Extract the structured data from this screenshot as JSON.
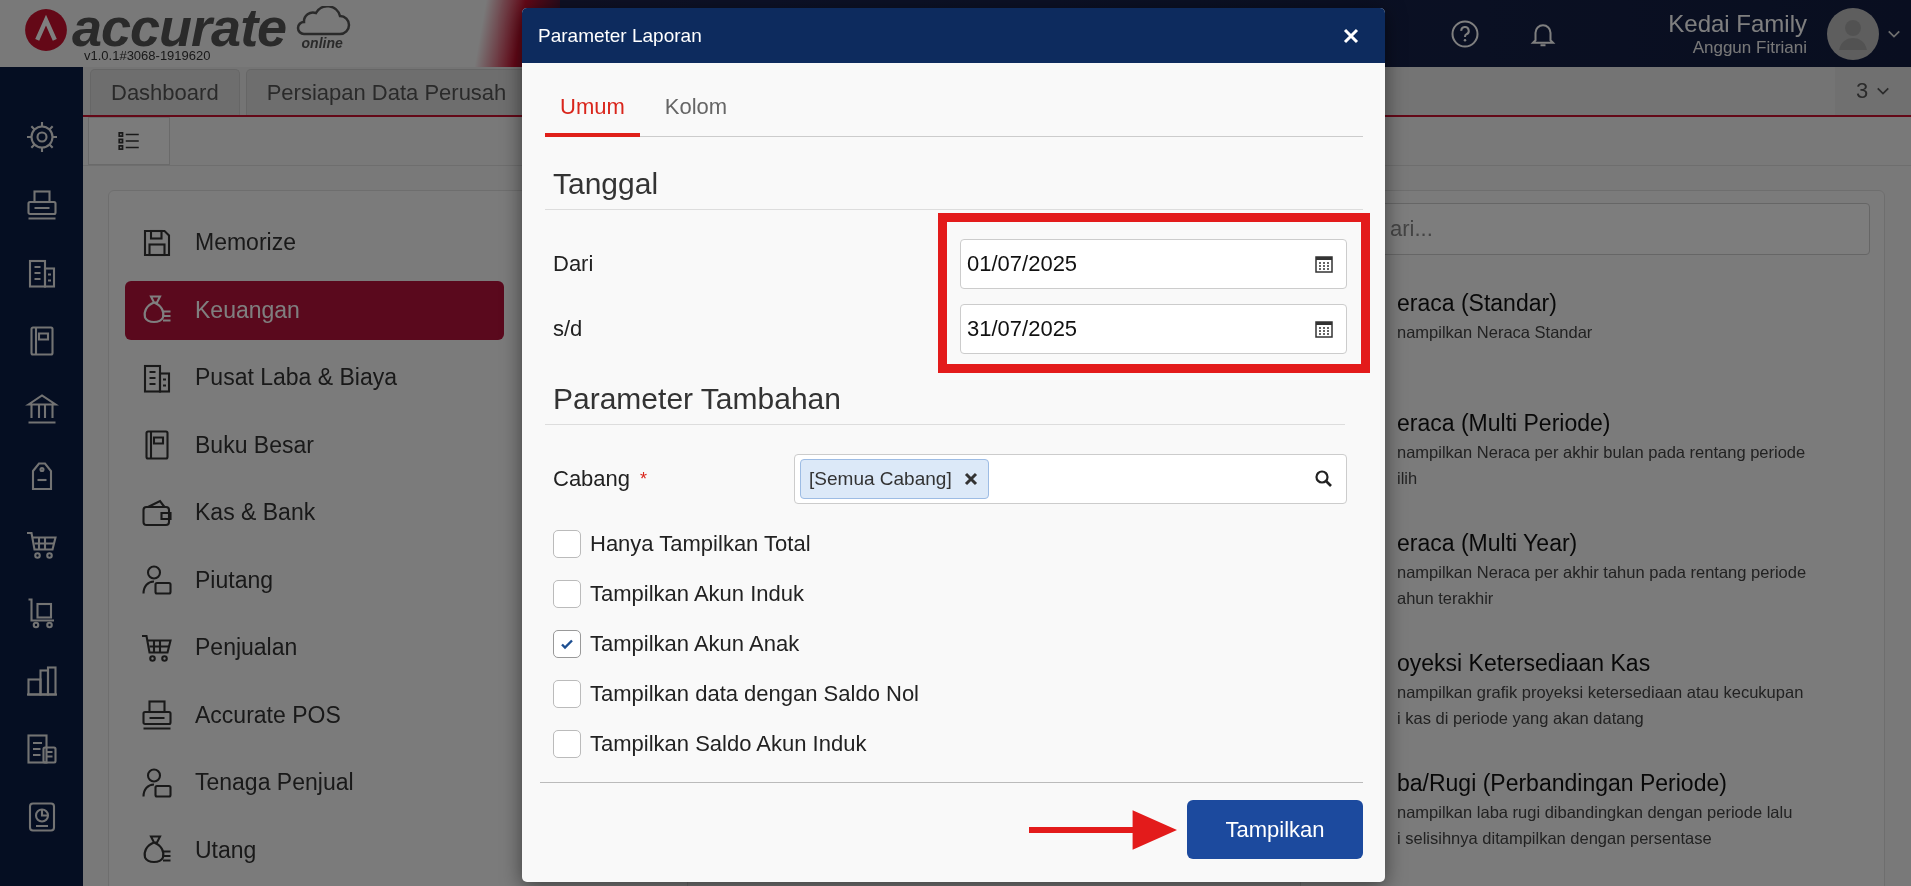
{
  "app": {
    "logo_text": "accurate",
    "logo_sub": "online",
    "version": "v1.0.1#3068-1919620"
  },
  "header": {
    "company": "Kedai Family",
    "user": "Anggun Fitriani"
  },
  "tabs": [
    {
      "label": "Dashboard",
      "selected": false
    },
    {
      "label": "Persiapan Data Perusah",
      "selected": false
    }
  ],
  "tab_count": "3",
  "menu": [
    {
      "label": "Memorize",
      "selected": false
    },
    {
      "label": "Keuangan",
      "selected": true
    },
    {
      "label": "Pusat Laba & Biaya",
      "selected": false
    },
    {
      "label": "Buku Besar",
      "selected": false
    },
    {
      "label": "Kas & Bank",
      "selected": false
    },
    {
      "label": "Piutang",
      "selected": false
    },
    {
      "label": "Penjualan",
      "selected": false
    },
    {
      "label": "Accurate POS",
      "selected": false
    },
    {
      "label": "Tenaga Penjual",
      "selected": false
    },
    {
      "label": "Utang",
      "selected": false
    }
  ],
  "reports": {
    "search_placeholder": "ari...",
    "items": [
      {
        "title": "eraca (Standar)",
        "lines": [
          "nampilkan Neraca Standar"
        ]
      },
      {
        "title": "eraca (Multi Periode)",
        "lines": [
          "nampilkan Neraca per akhir bulan pada rentang periode",
          "ilih"
        ]
      },
      {
        "title": "eraca (Multi Year)",
        "lines": [
          "nampilkan Neraca per akhir tahun pada rentang periode",
          "ahun terakhir"
        ]
      },
      {
        "title": "oyeksi Ketersediaan Kas",
        "lines": [
          "nampilkan grafik proyeksi ketersediaan atau kecukupan",
          "i kas di periode yang akan datang"
        ]
      },
      {
        "title": "ba/Rugi (Perbandingan Periode)",
        "lines": [
          "nampilkan laba rugi dibandingkan dengan periode lalu",
          "i selisihnya ditampilkan dengan persentase"
        ]
      }
    ]
  },
  "dialog": {
    "title": "Parameter Laporan",
    "tabs": [
      {
        "label": "Umum",
        "selected": true
      },
      {
        "label": "Kolom",
        "selected": false
      }
    ],
    "date_heading": "Tanggal",
    "dates": [
      {
        "label": "Dari",
        "value": "01/07/2025"
      },
      {
        "label": "s/d",
        "value": "31/07/2025"
      }
    ],
    "extra_heading": "Parameter Tambahan",
    "branch": {
      "label": "Cabang",
      "required_mark": "*",
      "tag": "[Semua Cabang]"
    },
    "options": [
      {
        "label": "Hanya Tampilkan Total",
        "checked": false
      },
      {
        "label": "Tampilkan Akun Induk",
        "checked": false
      },
      {
        "label": "Tampilkan Akun Anak",
        "checked": true
      },
      {
        "label": "Tampilkan data dengan Saldo Nol",
        "checked": false
      },
      {
        "label": "Tampilkan Saldo Akun Induk",
        "checked": false
      }
    ],
    "submit": "Tampilkan"
  }
}
